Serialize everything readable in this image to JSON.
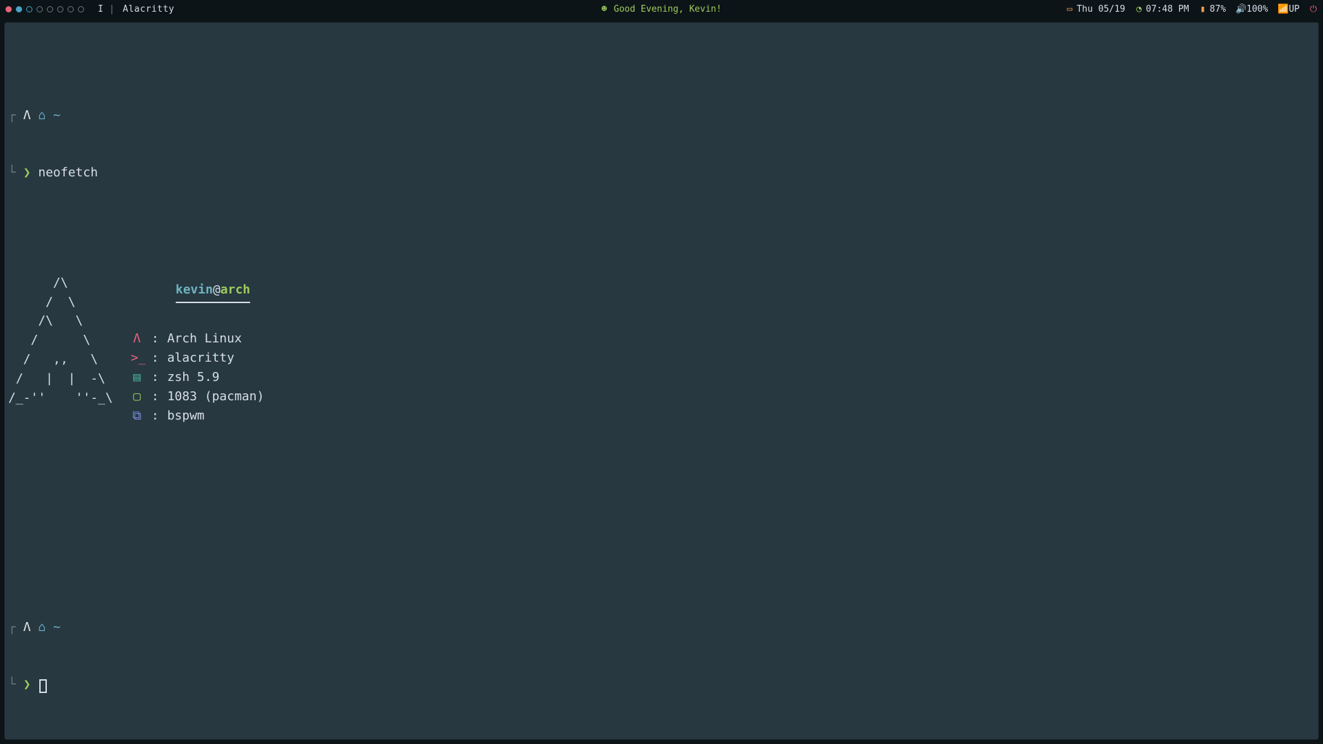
{
  "bar": {
    "workspaces": [
      {
        "state": "occupied-focused"
      },
      {
        "state": "occupied"
      },
      {
        "state": "active-ring"
      },
      {
        "state": "empty"
      },
      {
        "state": "empty"
      },
      {
        "state": "empty"
      },
      {
        "state": "empty"
      },
      {
        "state": "empty"
      }
    ],
    "ws_current": "I",
    "ws_separator": "|",
    "window_title": "Alacritty",
    "greeting": "Good Evening, Kevin!",
    "date": "Thu 05/19",
    "time": "07:48 PM",
    "battery": "87%",
    "volume": "100%",
    "network": "UP"
  },
  "terminal": {
    "prompt": {
      "arch_glyph": "Λ",
      "home_glyph": "⌂",
      "tilde": "~",
      "arrow": "❯",
      "command": "neofetch"
    },
    "ascii_art": "      /\\\n     /  \\\n    /\\   \\\n   /      \\\n  /   ,,   \\\n /   |  |  -\\\n/_-''    ''-_\\",
    "neofetch": {
      "user": "kevin",
      "at": "@",
      "host": "arch",
      "rows": [
        {
          "icon_class": "ic-os",
          "icon": "Λ",
          "value": "Arch Linux"
        },
        {
          "icon_class": "ic-term",
          "icon": ">_",
          "value": "alacritty"
        },
        {
          "icon_class": "ic-shell",
          "icon": "▤",
          "value": "zsh 5.9"
        },
        {
          "icon_class": "ic-pkg",
          "icon": "▢",
          "value": "1083 (pacman)"
        },
        {
          "icon_class": "ic-wm",
          "icon": "⧉",
          "value": "bspwm"
        }
      ]
    }
  }
}
